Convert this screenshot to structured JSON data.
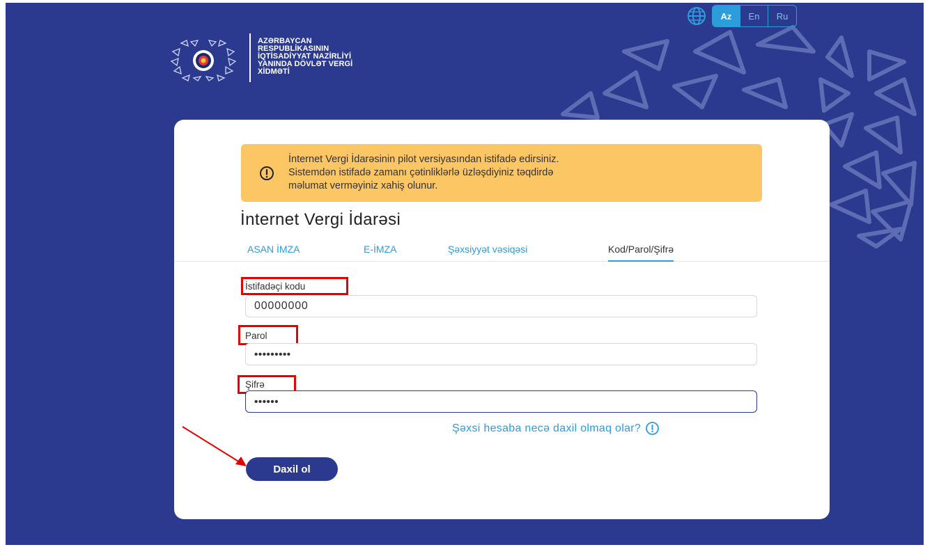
{
  "header": {
    "language_icon": "globe-icon",
    "languages": [
      {
        "label": "Az",
        "active": true
      },
      {
        "label": "En",
        "active": false
      },
      {
        "label": "Ru",
        "active": false
      }
    ],
    "logo": {
      "emblem_icon": "azerbaijan-emblem-icon",
      "lines": [
        "AZƏRBAYCAN",
        "RESPUBLİKASININ",
        "İQTİSADİYYAT NAZİRLİYİ",
        "YANINDA DÖVLƏT VERGİ",
        "XİDMƏTİ"
      ]
    }
  },
  "warning": {
    "icon": "exclamation-circle-icon",
    "lines": [
      "İnternet Vergi İdarəsinin pilot versiyasından istifadə edirsiniz.",
      "Sistemdən istifadə zamanı çətinliklərlə üzləşdiyiniz təqdirdə",
      "məlumat verməyiniz xahiş olunur."
    ]
  },
  "page_title": "İnternet Vergi İdarəsi",
  "tabs": [
    {
      "label": "ASAN İMZA",
      "active": false
    },
    {
      "label": "E-İMZA",
      "active": false
    },
    {
      "label": "Şəxsiyyət vəsiqəsi",
      "active": false
    },
    {
      "label": "Kod/Parol/Şifrə",
      "active": true
    }
  ],
  "form": {
    "user_code": {
      "label": "İstifadəçi kodu",
      "value": "00000000"
    },
    "password": {
      "label": "Parol",
      "value": "•••••••••"
    },
    "pin": {
      "label": "Şifrə",
      "value": "••••••"
    }
  },
  "help_link": {
    "label": "Şəxsi hesaba necə daxil olmaq olar?",
    "icon": "exclamation-circle-icon"
  },
  "login_button": {
    "label": "Daxil ol"
  },
  "colors": {
    "background": "#2b3a8f",
    "accent": "#2d9cdb",
    "warning": "#fdc664",
    "annotation": "#e60000"
  }
}
